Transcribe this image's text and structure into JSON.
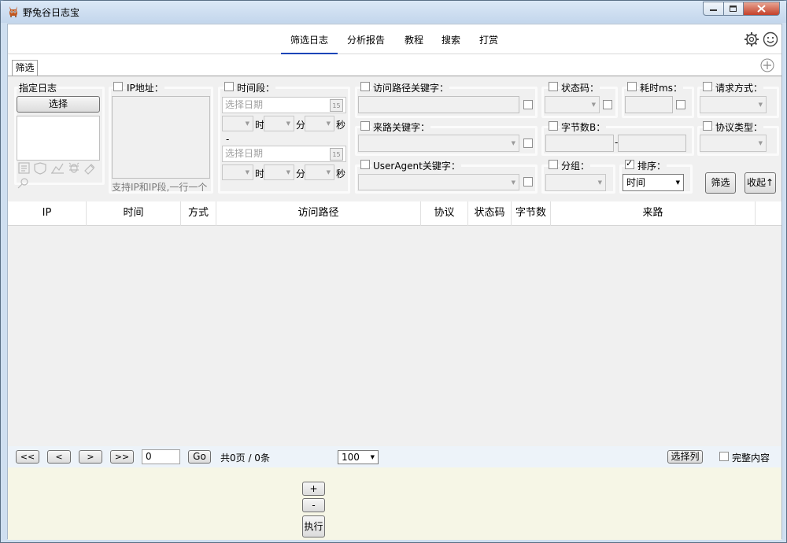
{
  "window": {
    "title": "野兔谷日志宝"
  },
  "nav": {
    "tabs": [
      "筛选日志",
      "分析报告",
      "教程",
      "搜索",
      "打赏"
    ]
  },
  "subtab": {
    "label": "筛选"
  },
  "filter": {
    "log": {
      "label": "指定日志",
      "select_button": "选择"
    },
    "ip": {
      "label": "IP地址：",
      "hint": "支持IP和IP段,一行一个"
    },
    "time": {
      "label": "时间段：",
      "date_placeholder": "选择日期",
      "cal_icon": "15",
      "hour": "时",
      "minute": "分",
      "second": "秒",
      "sep": "-"
    },
    "path": {
      "label": "访问路径关键字："
    },
    "referer": {
      "label": "来路关键字："
    },
    "ua": {
      "label": "UserAgent关键字："
    },
    "status": {
      "label": "状态码："
    },
    "elapsed": {
      "label": "耗时ms："
    },
    "method": {
      "label": "请求方式："
    },
    "bytes": {
      "label": "字节数B：",
      "sep": "-"
    },
    "protocol": {
      "label": "协议类型："
    },
    "group": {
      "label": "分组："
    },
    "sort": {
      "label": "排序：",
      "value": "时间",
      "checked": true
    },
    "filter_button": "筛选",
    "collapse_button": "收起↑"
  },
  "table": {
    "columns": [
      "IP",
      "时间",
      "方式",
      "访问路径",
      "协议",
      "状态码",
      "字节数",
      "来路"
    ]
  },
  "pager": {
    "first": "<<",
    "prev": "<",
    "next": ">",
    "last": ">>",
    "page_input": "0",
    "go": "Go",
    "summary": "共0页 / 0条",
    "page_size": "100",
    "select_cols": "选择列",
    "full_content": "完整内容"
  },
  "sql": {
    "plus": "+",
    "minus": "-",
    "run": "执行"
  }
}
